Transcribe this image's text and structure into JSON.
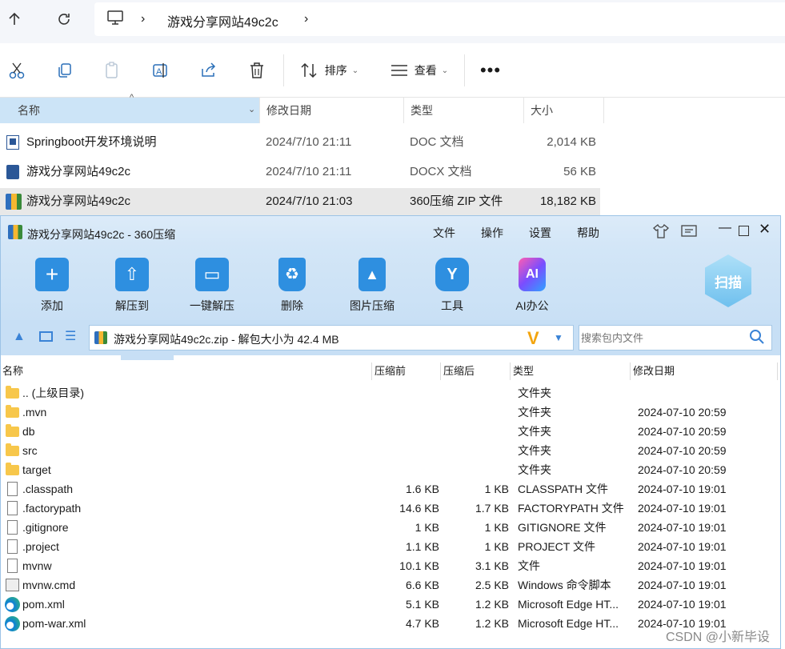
{
  "explorer": {
    "breadcrumb": [
      "游戏分享网站49c2c"
    ],
    "toolbar": {
      "sort_label": "排序",
      "view_label": "查看"
    },
    "columns": [
      "名称",
      "修改日期",
      "类型",
      "大小"
    ],
    "files": [
      {
        "name": "Springboot开发环境说明",
        "date": "2024/7/10 21:11",
        "type": "DOC 文档",
        "size": "2,014 KB"
      },
      {
        "name": "游戏分享网站49c2c",
        "date": "2024/7/10 21:11",
        "type": "DOCX 文档",
        "size": "56 KB"
      },
      {
        "name": "游戏分享网站49c2c",
        "date": "2024/7/10 21:03",
        "type": "360压缩 ZIP 文件",
        "size": "18,182 KB"
      }
    ]
  },
  "zip": {
    "title": "游戏分享网站49c2c - 360压缩",
    "menu": [
      "文件",
      "操作",
      "设置",
      "帮助"
    ],
    "tools": [
      "添加",
      "解压到",
      "一键解压",
      "删除",
      "图片压缩",
      "工具",
      "AI办公"
    ],
    "scan_label": "扫描",
    "path_text": "游戏分享网站49c2c.zip - 解包大小为 42.4 MB",
    "search_placeholder": "搜索包内文件",
    "columns": [
      "名称",
      "压缩前",
      "压缩后",
      "类型",
      "修改日期"
    ],
    "rows": [
      {
        "name": ".. (上级目录)",
        "before": "",
        "after": "",
        "type": "文件夹",
        "date": "",
        "icon": "folder"
      },
      {
        "name": ".mvn",
        "before": "",
        "after": "",
        "type": "文件夹",
        "date": "2024-07-10 20:59",
        "icon": "folder"
      },
      {
        "name": "db",
        "before": "",
        "after": "",
        "type": "文件夹",
        "date": "2024-07-10 20:59",
        "icon": "folder"
      },
      {
        "name": "src",
        "before": "",
        "after": "",
        "type": "文件夹",
        "date": "2024-07-10 20:59",
        "icon": "folder"
      },
      {
        "name": "target",
        "before": "",
        "after": "",
        "type": "文件夹",
        "date": "2024-07-10 20:59",
        "icon": "folder"
      },
      {
        "name": ".classpath",
        "before": "1.6 KB",
        "after": "1 KB",
        "type": "CLASSPATH 文件",
        "date": "2024-07-10 19:01",
        "icon": "file"
      },
      {
        "name": ".factorypath",
        "before": "14.6 KB",
        "after": "1.7 KB",
        "type": "FACTORYPATH 文件",
        "date": "2024-07-10 19:01",
        "icon": "file"
      },
      {
        "name": ".gitignore",
        "before": "1 KB",
        "after": "1 KB",
        "type": "GITIGNORE 文件",
        "date": "2024-07-10 19:01",
        "icon": "file"
      },
      {
        "name": ".project",
        "before": "1.1 KB",
        "after": "1 KB",
        "type": "PROJECT 文件",
        "date": "2024-07-10 19:01",
        "icon": "file"
      },
      {
        "name": "mvnw",
        "before": "10.1 KB",
        "after": "3.1 KB",
        "type": "文件",
        "date": "2024-07-10 19:01",
        "icon": "file"
      },
      {
        "name": "mvnw.cmd",
        "before": "6.6 KB",
        "after": "2.5 KB",
        "type": "Windows 命令脚本",
        "date": "2024-07-10 19:01",
        "icon": "cmd"
      },
      {
        "name": "pom.xml",
        "before": "5.1 KB",
        "after": "1.2 KB",
        "type": "Microsoft Edge HT...",
        "date": "2024-07-10 19:01",
        "icon": "edge"
      },
      {
        "name": "pom-war.xml",
        "before": "4.7 KB",
        "after": "1.2 KB",
        "type": "Microsoft Edge HT...",
        "date": "2024-07-10 19:01",
        "icon": "edge"
      }
    ]
  },
  "watermark": "CSDN @小新毕设"
}
